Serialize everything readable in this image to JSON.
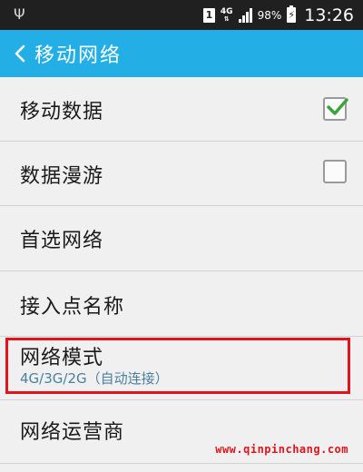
{
  "status_bar": {
    "sim_slot": "1",
    "network_type": "4G",
    "data_arrows": "⇅",
    "battery_percent": "98%",
    "battery_bolt": "⚡",
    "time": "13:26",
    "usb_icon_glyph": "Ψ"
  },
  "header": {
    "back_icon": "chevron-left-icon",
    "title": "移动网络",
    "color": "#24aee6"
  },
  "settings": [
    {
      "label": "移动数据",
      "has_checkbox": true,
      "checked": true
    },
    {
      "label": "数据漫游",
      "has_checkbox": true,
      "checked": false
    },
    {
      "label": "首选网络"
    },
    {
      "label": "接入点名称"
    },
    {
      "label": "网络模式",
      "sublabel": "4G/3G/2G（自动连接）",
      "highlighted": true
    },
    {
      "label": "网络运营商"
    }
  ],
  "colors": {
    "check_green": "#3ca23c",
    "highlight_red": "#e1141b",
    "sub_text": "#4a7fa0"
  },
  "watermark": "www.qinpinchang.com"
}
